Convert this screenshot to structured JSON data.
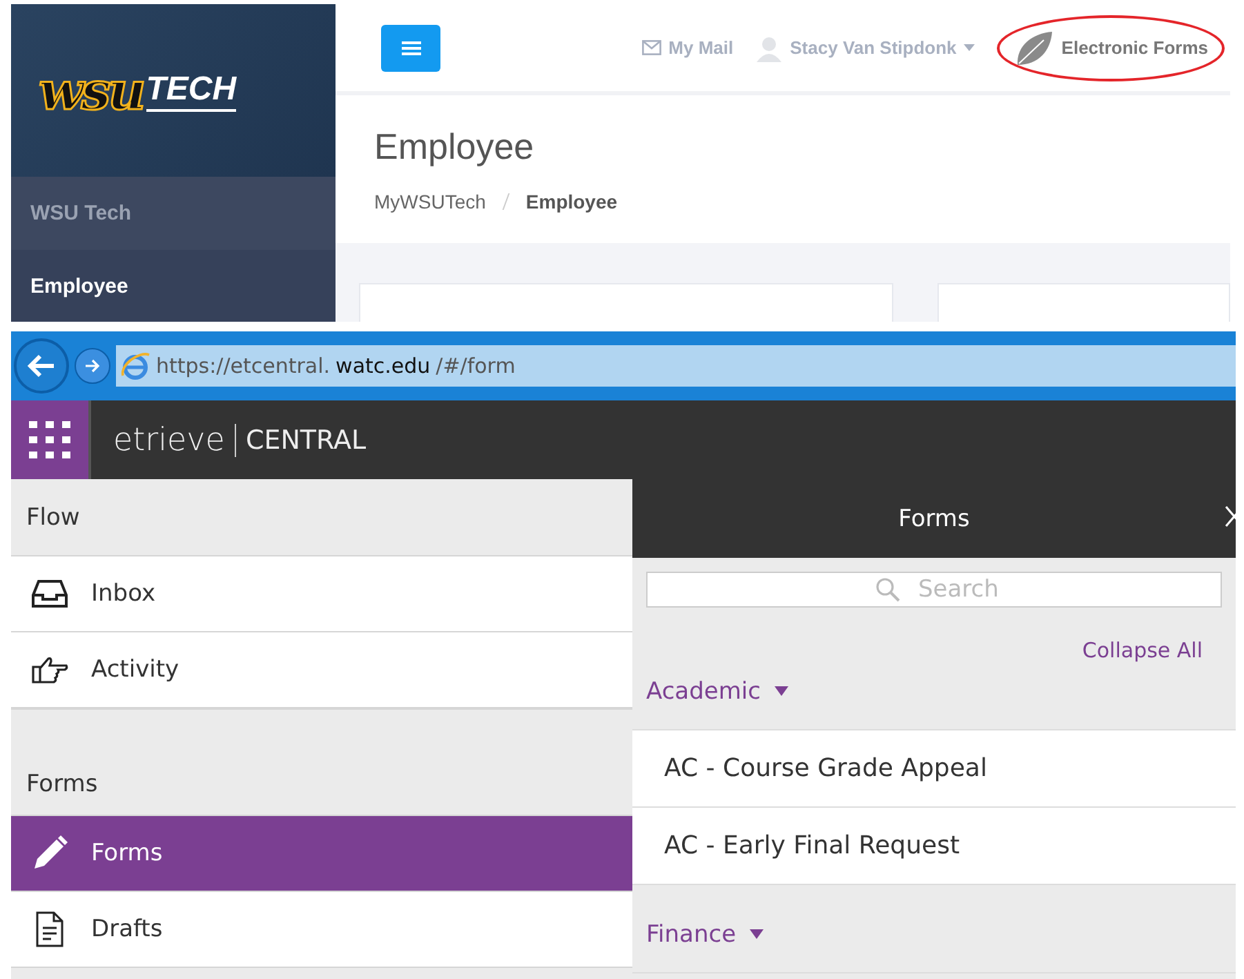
{
  "portal": {
    "logo": {
      "mark": "wsu",
      "word": "TECH"
    },
    "sidebar": {
      "items": [
        {
          "label": "WSU Tech",
          "selected": false
        },
        {
          "label": "Employee",
          "selected": true
        }
      ]
    },
    "topbar": {
      "links": [
        {
          "kind": "mail",
          "label": "My Mail",
          "highlighted": false
        },
        {
          "kind": "user",
          "label": "Stacy Van Stipdonk",
          "highlighted": false
        },
        {
          "kind": "leaf",
          "label": "Electronic Forms",
          "highlighted": true
        }
      ]
    },
    "title": "Employee",
    "breadcrumb": [
      {
        "label": "MyWSUTech",
        "current": false
      },
      {
        "label": "Employee",
        "current": true
      }
    ]
  },
  "browser": {
    "address": {
      "scheme": "https://etcentral.",
      "host": "watc.edu",
      "path": "/#/form"
    }
  },
  "app": {
    "logo": {
      "word": "etrieve",
      "product": "CENTRAL"
    },
    "nav": [
      {
        "heading": "Flow",
        "items": [
          {
            "kind": "inbox",
            "label": "Inbox",
            "selected": false
          },
          {
            "kind": "activity",
            "label": "Activity",
            "selected": false
          }
        ]
      },
      {
        "heading": "Forms",
        "items": [
          {
            "kind": "forms",
            "label": "Forms",
            "selected": true
          },
          {
            "kind": "drafts",
            "label": "Drafts",
            "selected": false
          }
        ]
      }
    ],
    "panel": {
      "title": "Forms",
      "search": {
        "placeholder": "Search"
      },
      "collapse": "Collapse All",
      "groups": [
        {
          "label": "Academic",
          "expanded": true,
          "items": [
            "AC - Course Grade Appeal",
            "AC - Early Final Request"
          ]
        },
        {
          "label": "Finance",
          "expanded": true
        }
      ]
    }
  }
}
